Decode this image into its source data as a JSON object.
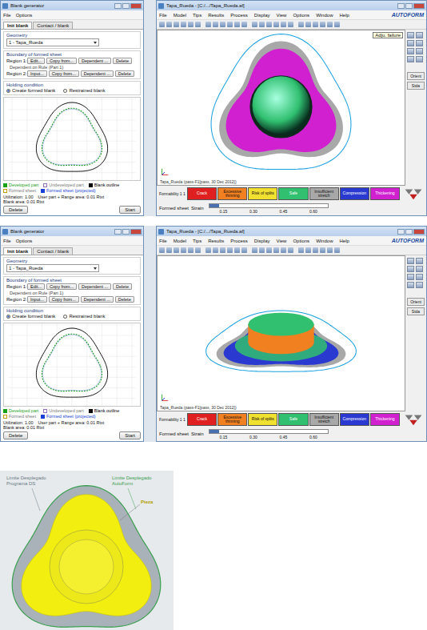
{
  "screenshots": [
    {
      "view": "top",
      "blank_generator": {
        "title": "Blank generator",
        "menu": [
          "File",
          "Options"
        ],
        "tabs": [
          {
            "label": "Init blank",
            "selected": true
          },
          {
            "label": "Contact / blank",
            "selected": false
          }
        ],
        "geometry_label": "Geometry",
        "geometry_value": "1 - Tapa_Rueda",
        "boundary_label": "Boundary of formed sheet",
        "regions": [
          {
            "label": "Region 1:",
            "buttons": [
              "Edit...",
              "Copy from...",
              "Dependent ...",
              "Delete"
            ]
          },
          {
            "label": "Region 2:",
            "buttons": [
              "Input...",
              "Copy from...",
              "Dependent ...",
              "Delete"
            ]
          }
        ],
        "dependent_note": "Dependent on Rule (Part 1)",
        "holding_label": "Holding condition",
        "holding_options": [
          {
            "label": "Create formed blank",
            "selected": true
          },
          {
            "label": "Restrained blank",
            "selected": false
          }
        ],
        "legend": [
          {
            "label": "Developed part",
            "checked": true,
            "color": "#18a018"
          },
          {
            "label": "Undeveloped part",
            "checked": false,
            "color": "#9070c0"
          },
          {
            "label": "Blank outline",
            "checked": true,
            "color": "#000000"
          },
          {
            "label": "Formed sheet",
            "checked": false,
            "color": "#c0a000"
          },
          {
            "label": "Formed sheet (projected)",
            "checked": true,
            "color": "#1a3fd6"
          }
        ],
        "stats": [
          "Utilization: 1.00",
          "User part + Range area: 0.01 Rtxt",
          "Blank area: 0.01 Rtxt"
        ],
        "buttons": [
          "Delete",
          "Start"
        ]
      },
      "autoform": {
        "title": "Tapa_Rueda - [C:/.../Tapa_Rueda.af]",
        "menu": [
          "File",
          "Model",
          "Tips",
          "Results",
          "Process",
          "Display",
          "View",
          "Options",
          "Window",
          "Help"
        ],
        "logo": "AUTOFORM",
        "tooltip": "Adju. failure",
        "side_buttons": [
          "Orient",
          "Stda"
        ],
        "status": "Tapa_Rueda (pass-F1[pass, 30 Dec 2012])",
        "legend": {
          "label": "Formability 1 1",
          "items": [
            {
              "label": "Crack",
              "color": "#e02020"
            },
            {
              "label": "Excessive thinning",
              "color": "#f08020"
            },
            {
              "label": "Risk of splits",
              "color": "#f0e030"
            },
            {
              "label": "Safe",
              "color": "#30c070"
            },
            {
              "label": "Insufficient stretch",
              "color": "#a8a8a8"
            },
            {
              "label": "Compression",
              "color": "#2a3ad0"
            },
            {
              "label": "Thickening",
              "color": "#d020d0"
            }
          ]
        },
        "sheet_label": "Formed sheet",
        "slider": {
          "label": "Strain",
          "level": 0.08,
          "ticks": [
            "0.15",
            "0.30",
            "0.45",
            "0.60"
          ]
        }
      }
    },
    {
      "view": "iso",
      "blank_generator": {
        "title": "Blank generator",
        "menu": [
          "File",
          "Options"
        ],
        "tabs": [
          {
            "label": "Init blank",
            "selected": true
          },
          {
            "label": "Contact / blank",
            "selected": false
          }
        ],
        "geometry_label": "Geometry",
        "geometry_value": "1 - Tapa_Rueda",
        "boundary_label": "Boundary of formed sheet",
        "regions": [
          {
            "label": "Region 1:",
            "buttons": [
              "Edit...",
              "Copy from...",
              "Dependent ...",
              "Delete"
            ]
          },
          {
            "label": "Region 2:",
            "buttons": [
              "Input...",
              "Copy from...",
              "Dependent ...",
              "Delete"
            ]
          }
        ],
        "dependent_note": "Dependent on Rule (Part 1)",
        "holding_label": "Holding condition",
        "holding_options": [
          {
            "label": "Create formed blank",
            "selected": true
          },
          {
            "label": "Restrained blank",
            "selected": false
          }
        ],
        "legend": [
          {
            "label": "Developed part",
            "checked": true,
            "color": "#18a018"
          },
          {
            "label": "Undeveloped part",
            "checked": false,
            "color": "#9070c0"
          },
          {
            "label": "Blank outline",
            "checked": true,
            "color": "#000000"
          },
          {
            "label": "Formed sheet",
            "checked": false,
            "color": "#c0a000"
          },
          {
            "label": "Formed sheet (projected)",
            "checked": true,
            "color": "#1a3fd6"
          }
        ],
        "stats": [
          "Utilization: 1.00",
          "User part + Range area: 0.01 Rtxt",
          "Blank area: 0.01 Rtxt"
        ],
        "buttons": [
          "Delete",
          "Start"
        ]
      },
      "autoform": {
        "title": "Tapa_Rueda - [C:/.../Tapa_Rueda.af]",
        "menu": [
          "File",
          "Model",
          "Tips",
          "Results",
          "Process",
          "Display",
          "View",
          "Options",
          "Window",
          "Help"
        ],
        "logo": "AUTOFORM",
        "tooltip": "",
        "side_buttons": [
          "Orient",
          "Stda"
        ],
        "status": "Tapa_Rueda (pass-F1[pass, 30 Dec 2012])",
        "legend": {
          "label": "Formability 1 1",
          "items": [
            {
              "label": "Crack",
              "color": "#e02020"
            },
            {
              "label": "Excessive thinning",
              "color": "#f08020"
            },
            {
              "label": "Risk of splits",
              "color": "#f0e030"
            },
            {
              "label": "Safe",
              "color": "#30c070"
            },
            {
              "label": "Insufficient stretch",
              "color": "#a8a8a8"
            },
            {
              "label": "Compression",
              "color": "#2a3ad0"
            },
            {
              "label": "Thickening",
              "color": "#d020d0"
            }
          ]
        },
        "sheet_label": "Formed sheet",
        "slider": {
          "label": "Strain",
          "level": 0.08,
          "ticks": [
            "0.15",
            "0.30",
            "0.45",
            "0.60"
          ]
        }
      }
    }
  ],
  "figure": {
    "labels": [
      {
        "text": "Limite Desplegado Programa DS",
        "color": "#6a7a86"
      },
      {
        "text": "Limite Desplegado AutoForm",
        "color": "#3aa050"
      },
      {
        "text": "Pieza",
        "color": "#b0a000"
      }
    ]
  }
}
